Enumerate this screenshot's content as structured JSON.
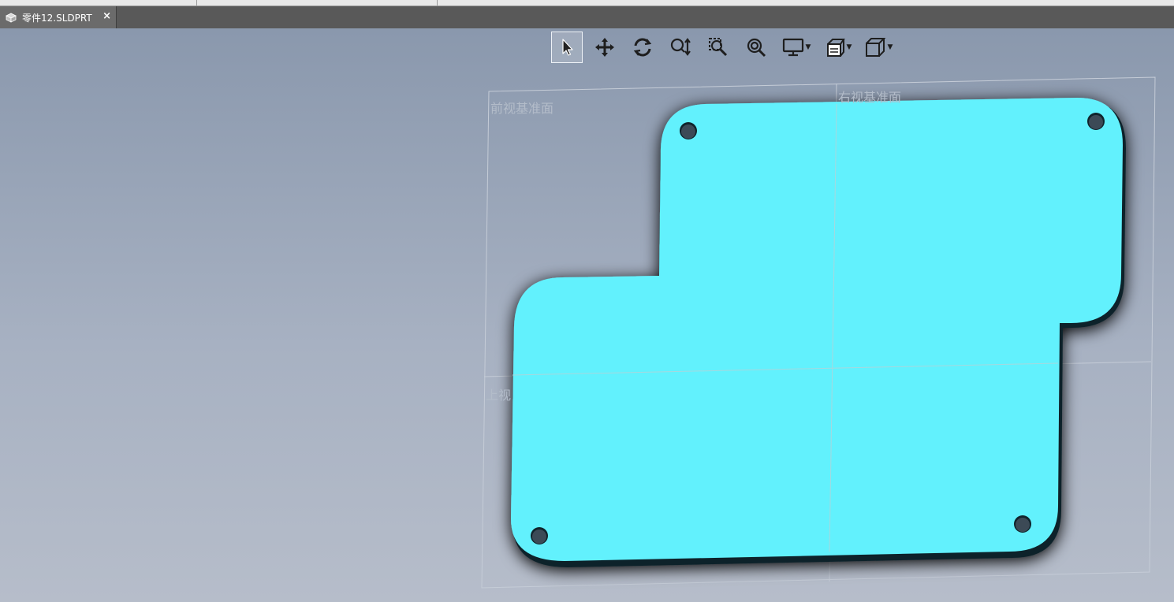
{
  "document": {
    "tab_title": "零件12.SLDPRT",
    "tab_close": "×",
    "tab_icon": "part-document-icon"
  },
  "toolbar": {
    "items": [
      {
        "name": "select",
        "icon": "pointer-arrow-icon",
        "active": true
      },
      {
        "name": "pan",
        "icon": "pan-move-icon"
      },
      {
        "name": "rotate",
        "icon": "rotate-view-icon"
      },
      {
        "name": "zoom-in-out",
        "icon": "zoom-in-out-icon"
      },
      {
        "name": "zoom-to-area",
        "icon": "zoom-to-area-icon"
      },
      {
        "name": "zoom-to-fit",
        "icon": "zoom-to-fit-icon"
      },
      {
        "name": "display-style",
        "icon": "monitor-display-icon",
        "dropdown": true
      },
      {
        "name": "hide-show",
        "icon": "hide-show-items-icon",
        "dropdown": true
      },
      {
        "name": "view-orientation",
        "icon": "view-cube-icon",
        "dropdown": true
      }
    ]
  },
  "planes": {
    "front": "前视基准面",
    "right": "右视基准面",
    "top": "上视"
  },
  "colors": {
    "part_face": "#62f1fd",
    "part_edge": "#10242c",
    "hole": "#3c4a56",
    "plane_line": "#c5ccd7",
    "tab_bar": "#595959"
  }
}
